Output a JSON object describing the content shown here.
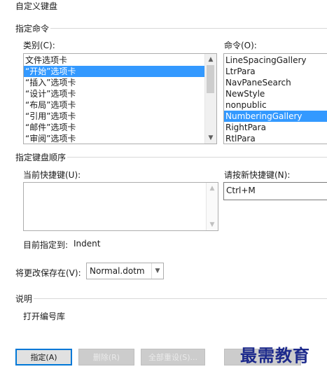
{
  "window": {
    "title": "自定义键盘"
  },
  "specify_command": {
    "section_title": "指定命令",
    "categories_label": "类别(C):",
    "categories": [
      "文件选项卡",
      "“开始”选项卡",
      "“插入”选项卡",
      "“设计”选项卡",
      "“布局”选项卡",
      "“引用”选项卡",
      "“邮件”选项卡",
      "“审阅”选项卡"
    ],
    "categories_selected": 1,
    "commands_label": "命令(O):",
    "commands": [
      "LineSpacingGallery",
      "LtrPara",
      "NavPaneSearch",
      "NewStyle",
      "nonpublic",
      "NumberingGallery",
      "RightPara",
      "RtlPara"
    ],
    "commands_selected": 5
  },
  "keyboard_sequence": {
    "section_title": "指定键盘顺序",
    "current_keys_label": "当前快捷键(U):",
    "current_keys": [],
    "new_key_label": "请按新快捷键(N):",
    "new_key_value": "Ctrl+M",
    "currently_assigned_label": "目前指定到:",
    "currently_assigned_value": "Indent"
  },
  "save_in": {
    "label": "将更改保存在(V):",
    "value": "Normal.dotm"
  },
  "description": {
    "section_title": "说明",
    "text": "打开编号库"
  },
  "buttons": {
    "assign": "指定(A)",
    "remove": "删除(R)",
    "reset_all": "全部重设(S)..."
  },
  "watermark": "最需教育",
  "icons": {
    "scroll_up": "chevron-up-icon",
    "scroll_down": "chevron-down-icon",
    "dropdown": "chevron-down-icon"
  }
}
